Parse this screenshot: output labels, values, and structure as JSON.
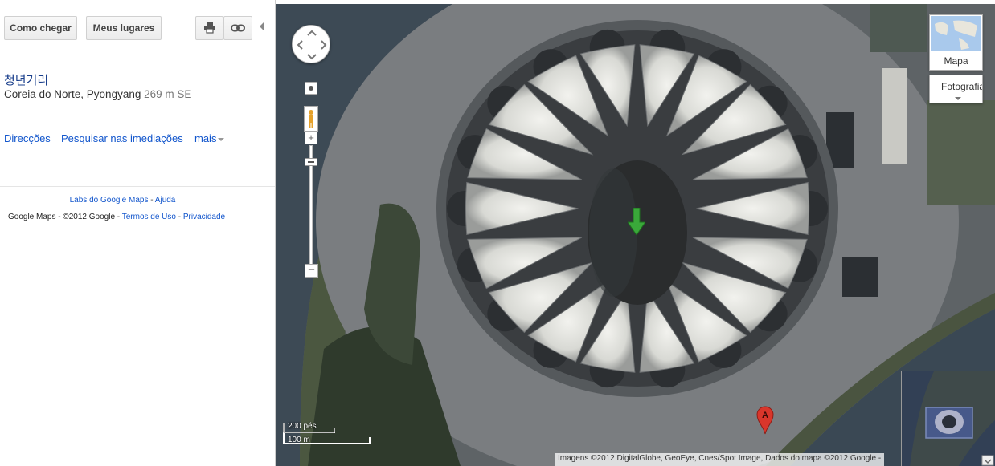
{
  "toolbar": {
    "directions_label": "Como chegar",
    "places_label": "Meus lugares",
    "print_icon": "printer-icon",
    "link_icon": "link-icon"
  },
  "place": {
    "title": "청년거리",
    "location": "Coreia do Norte, Pyongyang",
    "distance": "269 m SE"
  },
  "actions": {
    "directions": "Direcções",
    "nearby": "Pesquisar nas imediações",
    "more": "mais"
  },
  "footer": {
    "labs": "Labs do Google Maps",
    "sep": " - ",
    "help": "Ajuda",
    "copyright": "Google Maps - ©2012 Google - ",
    "terms": "Termos de Uso",
    "privacy": "Privacidade"
  },
  "map": {
    "type_map": "Mapa",
    "type_photo": "Fotografia",
    "scale_feet": "200 pés",
    "scale_meters": "100 m",
    "attribution": "Imagens ©2012 DigitalGlobe, GeoEye, Cnes/Spot Image, Dados do mapa ©2012 Google -",
    "marker_label": "A",
    "zoom_in_label": "+",
    "zoom_out_label": "−"
  },
  "colors": {
    "link": "#1155cc",
    "title": "#1a3f8c",
    "marker": "#d9362b",
    "arrow": "#3aa83a"
  }
}
